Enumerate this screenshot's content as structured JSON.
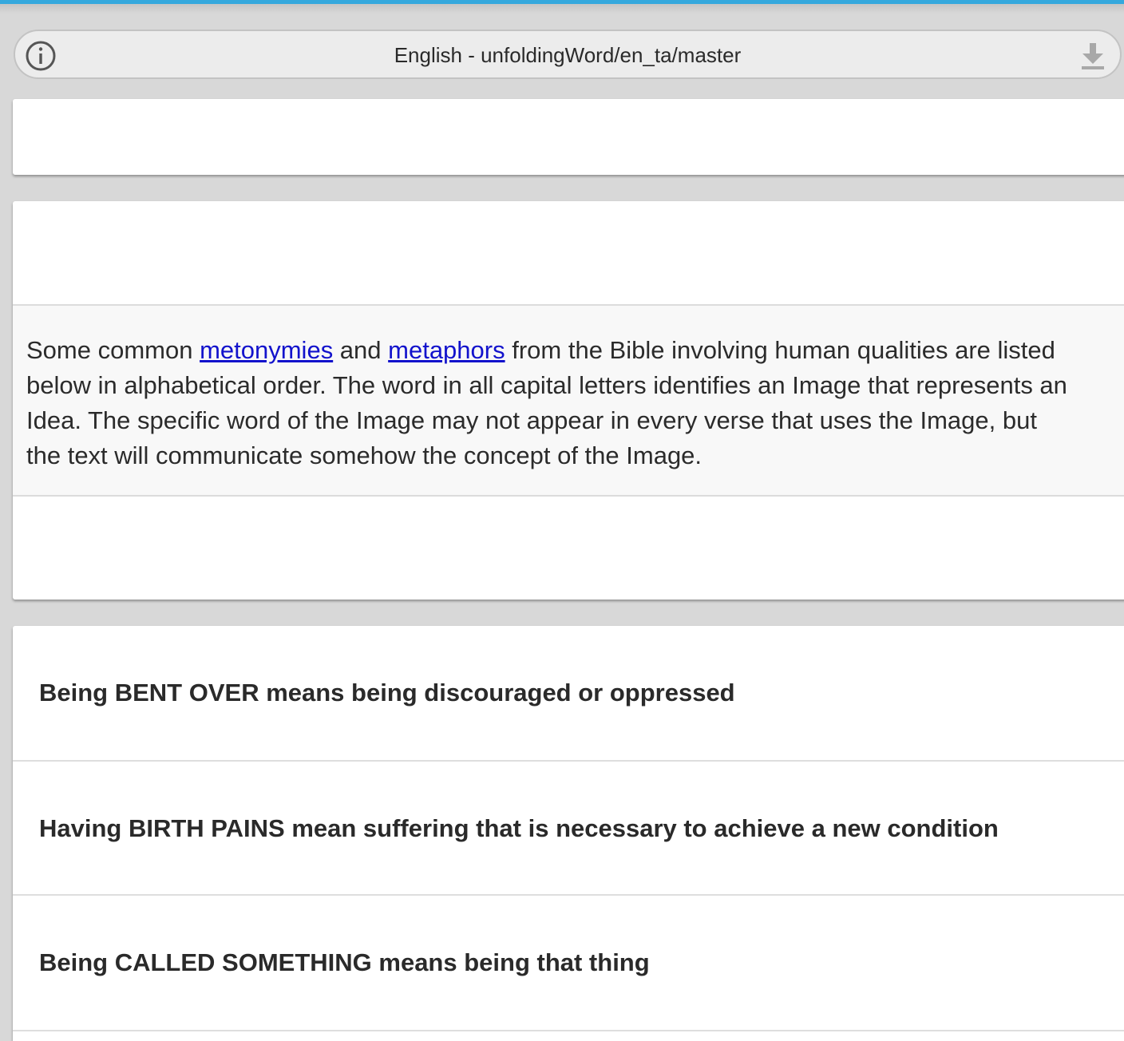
{
  "header": {
    "title": "English - unfoldingWord/en_ta/master",
    "info_icon": "info-circle-icon",
    "download_icon": "download-icon"
  },
  "intro": {
    "part1": "Some common ",
    "link1": "metonymies",
    "part2": " and ",
    "link2": "metaphors",
    "part3": " from the Bible involving human qualities are listed",
    "line2": "below in alphabetical order. The word in all capital letters identifies an Image that represents an",
    "line3": "Idea. The specific word of the Image may not appear in every verse that uses the Image, but",
    "line4": "the text will communicate somehow the concept of the Image."
  },
  "items": [
    {
      "label": "Being BENT OVER means being discouraged or oppressed"
    },
    {
      "label": "Having BIRTH PAINS mean suffering that is necessary to achieve a new condition"
    },
    {
      "label": "Being CALLED SOMETHING means being that thing"
    }
  ],
  "colors": {
    "accent": "#35a8dd",
    "link": "#1212cc",
    "background": "#d8d8d8"
  }
}
